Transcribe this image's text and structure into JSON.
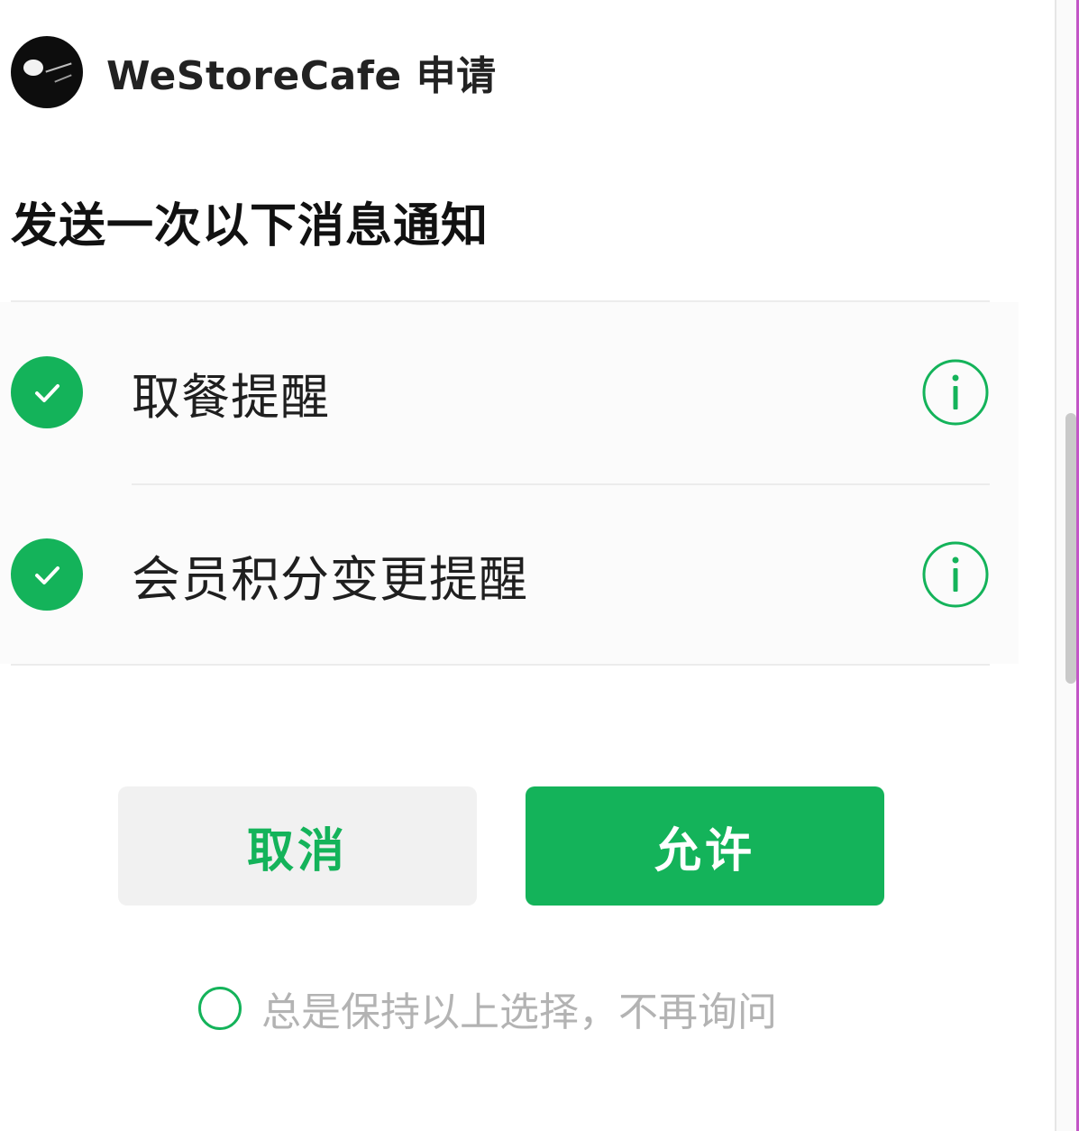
{
  "header": {
    "app_name": "WeStoreCafe 申请"
  },
  "subtitle": "发送一次以下消息通知",
  "items": [
    {
      "label": "取餐提醒",
      "checked": true
    },
    {
      "label": "会员积分变更提醒",
      "checked": true
    }
  ],
  "buttons": {
    "cancel": "取消",
    "allow": "允许"
  },
  "always": {
    "label": "总是保持以上选择，不再询问",
    "checked": false
  },
  "colors": {
    "accent": "#14b35a",
    "cancel_bg": "#f1f1f1",
    "muted_text": "#b3b3b3"
  },
  "icons": {
    "check": "check-circle-icon",
    "info": "info-icon",
    "radio": "radio-icon"
  }
}
